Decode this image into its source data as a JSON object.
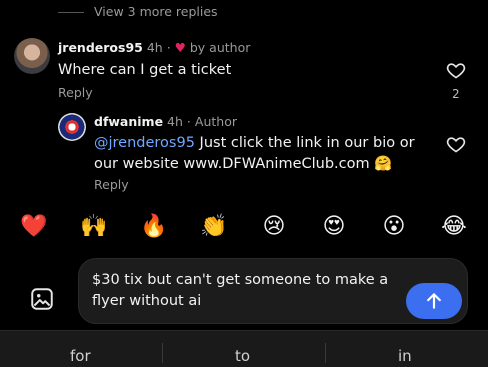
{
  "thread": {
    "view_more": "View 3 more replies"
  },
  "comment1": {
    "username": "jrenderos95",
    "time": "4h",
    "liked_by": "by author",
    "text": "Where can I get a ticket",
    "reply_label": "Reply",
    "like_count": "2"
  },
  "comment2": {
    "username": "dfwanime",
    "time": "4h",
    "author_badge": "Author",
    "mention": "@jrenderos95",
    "text": " Just click the link in our bio or our website www.DFWAnimeClub.com",
    "emoji": "🤗",
    "reply_label": "Reply"
  },
  "reactions": [
    "❤️",
    "🙌",
    "🔥",
    "👏",
    "😢",
    "😍",
    "😮",
    "😂"
  ],
  "composer": {
    "text": "$30 tix but can't get someone to make a flyer without ai"
  },
  "keyboard": {
    "suggestions": [
      "for",
      "to",
      "in"
    ]
  },
  "colors": {
    "accent": "#3b6ff0",
    "mention": "#6ea8ff",
    "heart": "#e0245e"
  }
}
